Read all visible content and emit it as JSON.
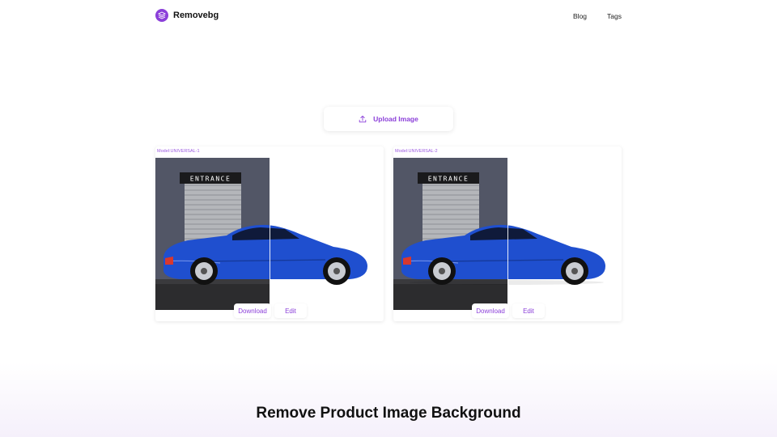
{
  "header": {
    "brand": "Removebg",
    "nav": [
      {
        "label": "Blog"
      },
      {
        "label": "Tags"
      }
    ]
  },
  "upload": {
    "label": "Upload Image"
  },
  "cards": [
    {
      "model_label": "Model:UNIVERSAL-1",
      "sign_text": "ENTRANCE",
      "download_label": "Download",
      "edit_label": "Edit"
    },
    {
      "model_label": "Model:UNIVERSAL-2",
      "sign_text": "ENTRANCE",
      "download_label": "Download",
      "edit_label": "Edit"
    }
  ],
  "section": {
    "title": "Remove Product Image Background"
  },
  "colors": {
    "accent": "#8b3fd9",
    "car": "#1f4fcf"
  },
  "icons": {
    "logo": "layers-icon",
    "upload": "upload-icon"
  }
}
